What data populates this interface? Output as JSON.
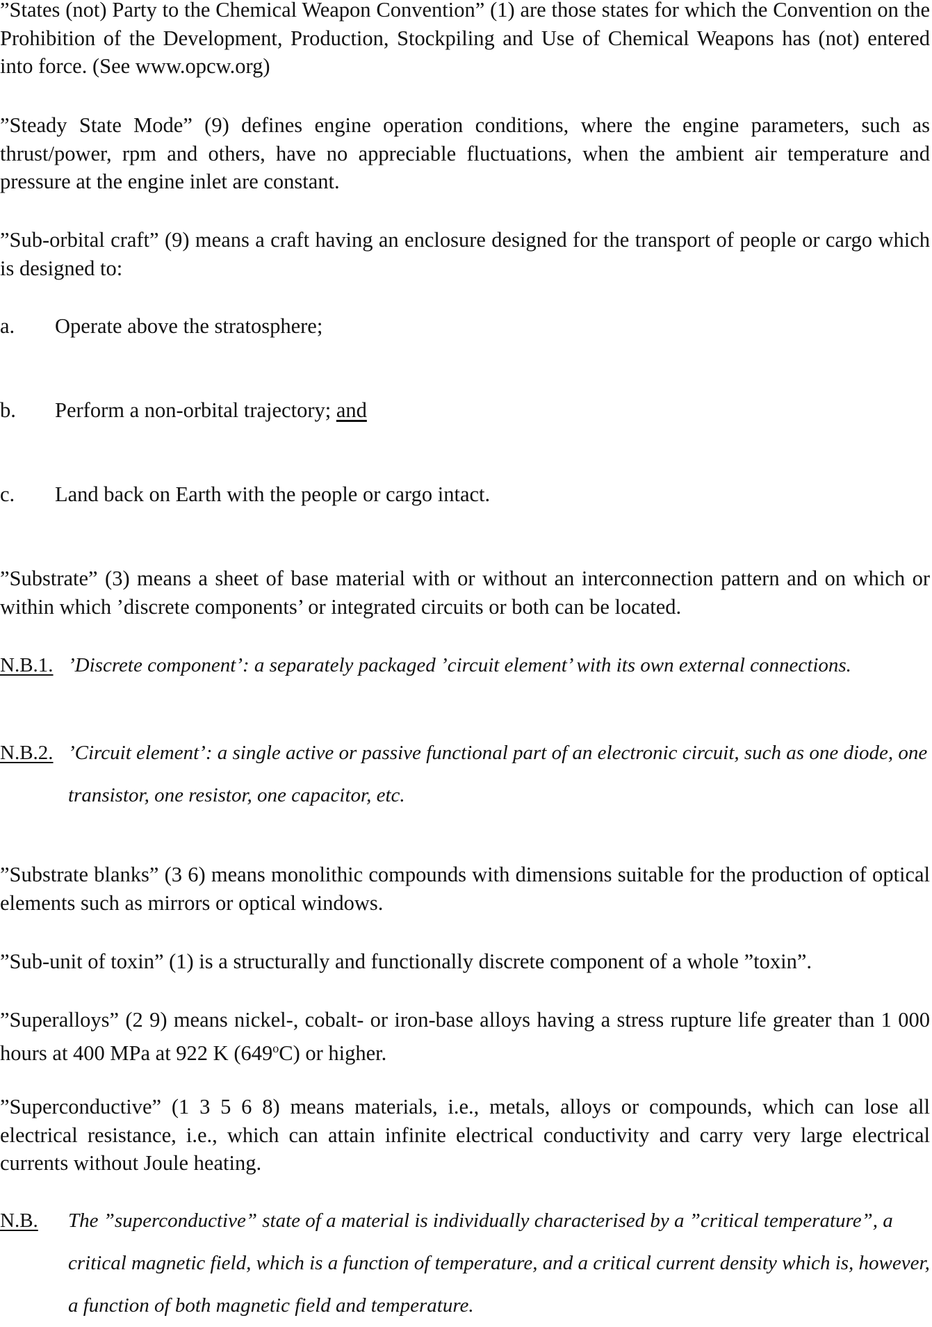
{
  "document": {
    "paragraphs": {
      "states_party": "”States (not) Party to the Chemical Weapon Convention” (1) are those states for which the Convention on the Prohibition of the Development, Production, Stockpiling and Use of Chemical Weapons has (not) entered into force. (See www.opcw.org)",
      "steady_state": "”Steady State Mode” (9) defines engine operation conditions, where the engine parameters, such as thrust/power, rpm and others, have no appreciable fluctuations, when the ambient air temperature and pressure at the engine inlet are constant.",
      "sub_orbital": "”Sub-orbital craft” (9) means a craft having an enclosure designed for the transport of people or cargo which is designed to:",
      "substrate": "”Substrate” (3) means a sheet of base material with or without an interconnection pattern and on which or within which ’discrete components’ or integrated circuits or both can be located.",
      "substrate_blanks": "”Substrate blanks” (3 6) means monolithic compounds with dimensions suitable for the production of optical elements such as mirrors or optical windows.",
      "sub_unit_toxin": "”Sub-unit of toxin” (1) is a structurally and functionally discrete component of a whole ”toxin”.",
      "superalloys": "”Superalloys” (2 9) means nickel-, cobalt- or iron-base alloys having a stress rupture life greater than 1 000 hours at 400 MPa at 922 K (649",
      "superalloys_deg": "o",
      "superalloys_end": "C) or higher.",
      "superconductive": "”Superconductive” (1 3 5 6 8) means materials, i.e., metals, alloys or compounds, which can lose all electrical resistance, i.e., which can attain infinite electrical conductivity and carry very large electrical currents without Joule heating."
    },
    "sub_orbital_items": [
      {
        "marker": "a.",
        "text": "Operate above the stratosphere;"
      },
      {
        "marker": "b.",
        "text": "Perform a non-orbital trajectory; ",
        "suffix": "and"
      },
      {
        "marker": "c.",
        "text": "Land back on Earth with the people or cargo intact."
      }
    ],
    "notes": {
      "nb1_label": "N.B.1.",
      "nb1_text": "’Discrete component’: a separately packaged ’circuit element’ with its own external connections.",
      "nb2_label": "N.B.2.",
      "nb2_text": "’Circuit element’: a single active or passive functional part of an electronic circuit, such as one diode, one transistor, one resistor, one capacitor, etc.",
      "nb_label": "N.B.",
      "nb_text": "The ”superconductive” state of a material is individually characterised by a ”critical temperature”, a critical magnetic field, which is a function of temperature, and a critical current density which is, however, a function of both magnetic field and temperature."
    }
  }
}
